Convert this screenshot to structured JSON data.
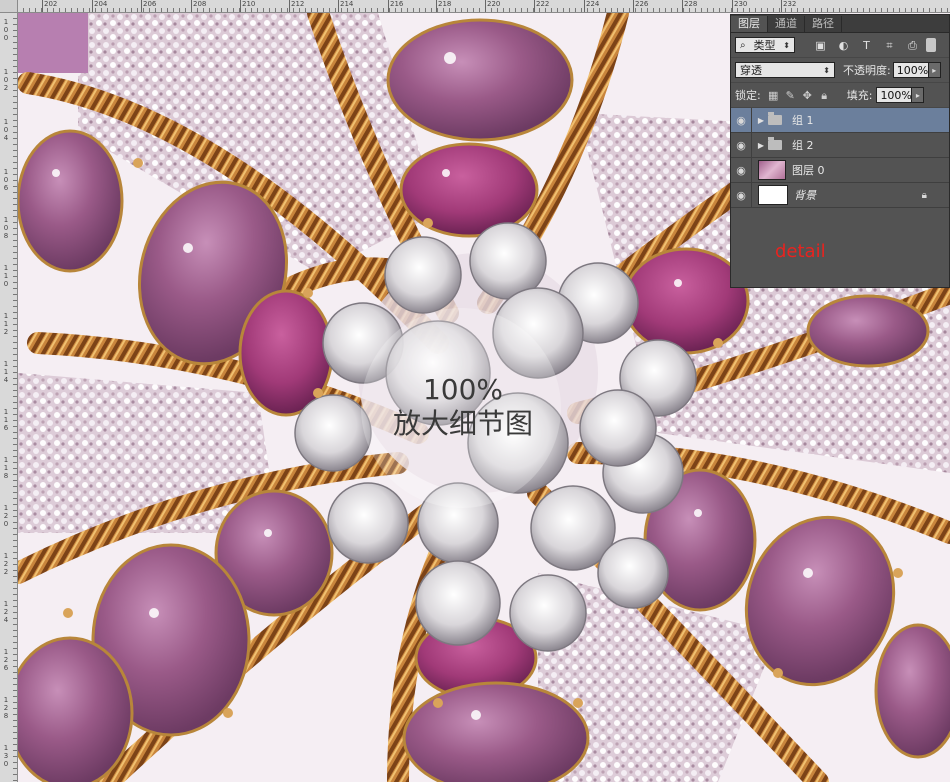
{
  "ruler": {
    "top_ticks": [
      "202",
      "204",
      "206",
      "208",
      "210",
      "212",
      "214",
      "216",
      "218",
      "220",
      "222",
      "224",
      "226",
      "228",
      "230",
      "232"
    ],
    "left_ticks": [
      "100",
      "102",
      "104",
      "106",
      "108",
      "110",
      "112",
      "114",
      "116",
      "118",
      "120",
      "122",
      "124",
      "126",
      "128",
      "130"
    ]
  },
  "overlay": {
    "zoom": "100%",
    "caption": "放大细节图"
  },
  "panel": {
    "tabs": [
      "图层",
      "通道",
      "路径"
    ],
    "filter": {
      "kind_label": "类型",
      "icons": [
        "image-filter-icon",
        "adjustment-filter-icon",
        "type-filter-icon",
        "shape-filter-icon",
        "smart-object-filter-icon"
      ]
    },
    "blend": {
      "mode": "穿透",
      "opacity_label": "不透明度:",
      "opacity": "100%"
    },
    "lock": {
      "label": "锁定:",
      "fill_label": "填充:",
      "fill": "100%"
    },
    "layers": [
      {
        "name": "组 1",
        "type": "group",
        "selected": true
      },
      {
        "name": "组 2",
        "type": "group",
        "selected": false
      },
      {
        "name": "图层 0",
        "type": "image",
        "selected": false
      },
      {
        "name": "背景",
        "type": "background",
        "selected": false
      }
    ],
    "note": "detail"
  },
  "colors": {
    "accent_red": "#e8231f",
    "selected_row": "#6b7f9c"
  }
}
